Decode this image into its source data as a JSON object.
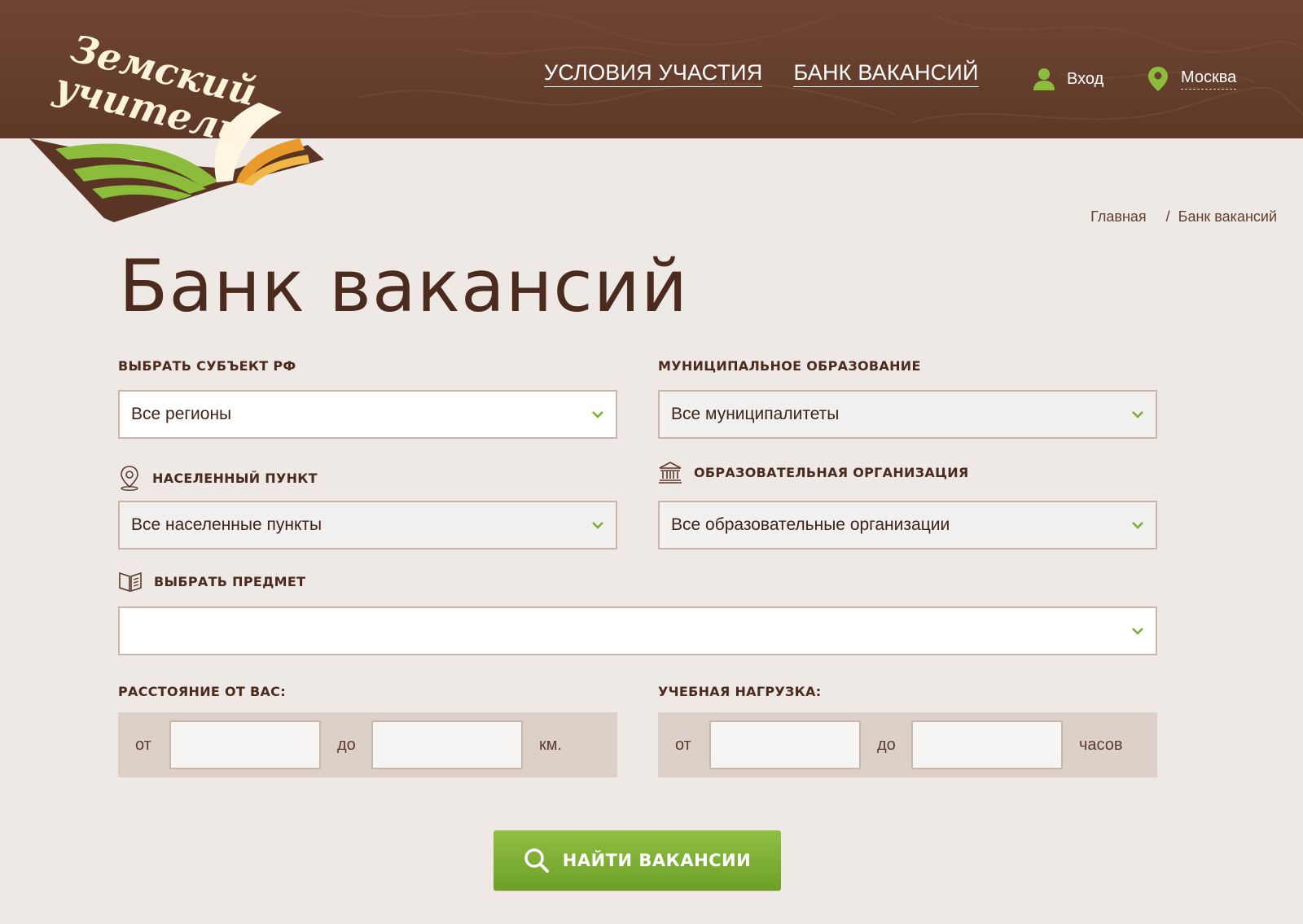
{
  "logo": {
    "line1": "Земский",
    "line2": "учитель"
  },
  "nav": {
    "items": [
      "УСЛОВИЯ УЧАСТИЯ",
      "БАНК ВАКАНСИЙ"
    ]
  },
  "user": {
    "login_label": "Вход",
    "city": "Москва"
  },
  "breadcrumb": {
    "home": "Главная",
    "separator": "/",
    "current": "Банк вакансий"
  },
  "page_title": "Банк вакансий",
  "filters": {
    "region": {
      "label": "ВЫБРАТЬ СУБЪЕКТ РФ",
      "value": "Все регионы"
    },
    "municipality": {
      "label": "МУНИЦИПАЛЬНОЕ ОБРАЗОВАНИЕ",
      "value": "Все муниципалитеты"
    },
    "locality": {
      "label": "НАСЕЛЕННЫЙ ПУНКТ",
      "value": "Все населенные пункты"
    },
    "organization": {
      "label": "ОБРАЗОВАТЕЛЬНАЯ ОРГАНИЗАЦИЯ",
      "value": "Все образовательные организации"
    },
    "subject": {
      "label": "ВЫБРАТЬ ПРЕДМЕТ",
      "value": ""
    },
    "distance": {
      "label": "РАССТОЯНИЕ ОТ ВАС:",
      "from": "от",
      "to": "до",
      "unit": "км."
    },
    "workload": {
      "label": "УЧЕБНАЯ НАГРУЗКА:",
      "from": "от",
      "to": "до",
      "unit": "часов"
    }
  },
  "search_button": "НАЙТИ ВАКАНСИИ",
  "colors": {
    "header_brown": "#6f4533",
    "background": "#efe9e6",
    "text_brown": "#4a2b1d",
    "accent_green": "#7aab33"
  }
}
